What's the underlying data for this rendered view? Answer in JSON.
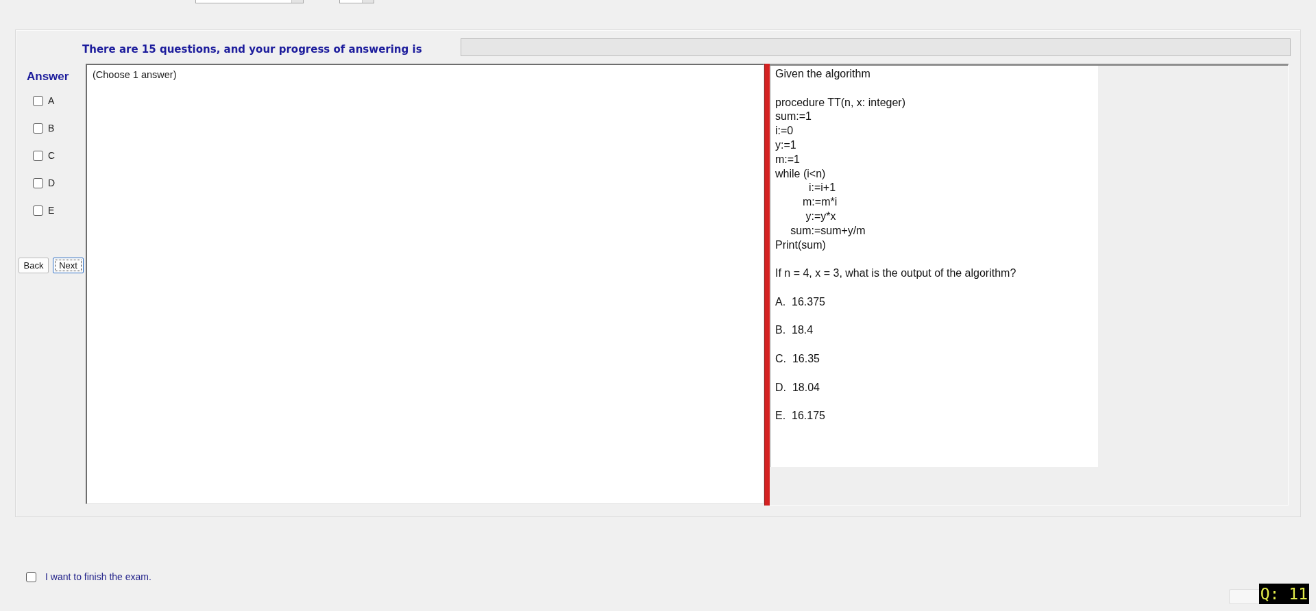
{
  "header": {
    "progress_text": "There are 15 questions, and your progress of answering is",
    "progress": {
      "level": 0
    }
  },
  "answer_panel": {
    "title": "Answer",
    "choices": [
      {
        "label": "A",
        "checked": false
      },
      {
        "label": "B",
        "checked": false
      },
      {
        "label": "C",
        "checked": false
      },
      {
        "label": "D",
        "checked": false
      },
      {
        "label": "E",
        "checked": false
      }
    ],
    "buttons": [
      {
        "label": "Back",
        "focused": false
      },
      {
        "label": "Next",
        "focused": true
      }
    ]
  },
  "answer_box": {
    "hint": "(Choose 1 answer)"
  },
  "question": {
    "paragraphs": [
      [
        "Given the algorithm"
      ],
      [
        "procedure TT(n, x: integer)",
        "sum:=1",
        "i:=0",
        "y:=1",
        "m:=1",
        "while (i<n)",
        "           i:=i+1",
        "         m:=m*i",
        "          y:=y*x",
        "     sum:=sum+y/m",
        "Print(sum)"
      ],
      [
        "If n = 4, x = 3, what is the output of the algorithm?"
      ]
    ],
    "options": [
      "A.  16.375",
      "B.  18.4",
      "C.  16.35",
      "D.  18.04",
      "E.  16.175"
    ]
  },
  "footer": {
    "finish": {
      "label": "I want to finish the exam.",
      "checked": false
    },
    "question_badge": "Q: 11"
  }
}
